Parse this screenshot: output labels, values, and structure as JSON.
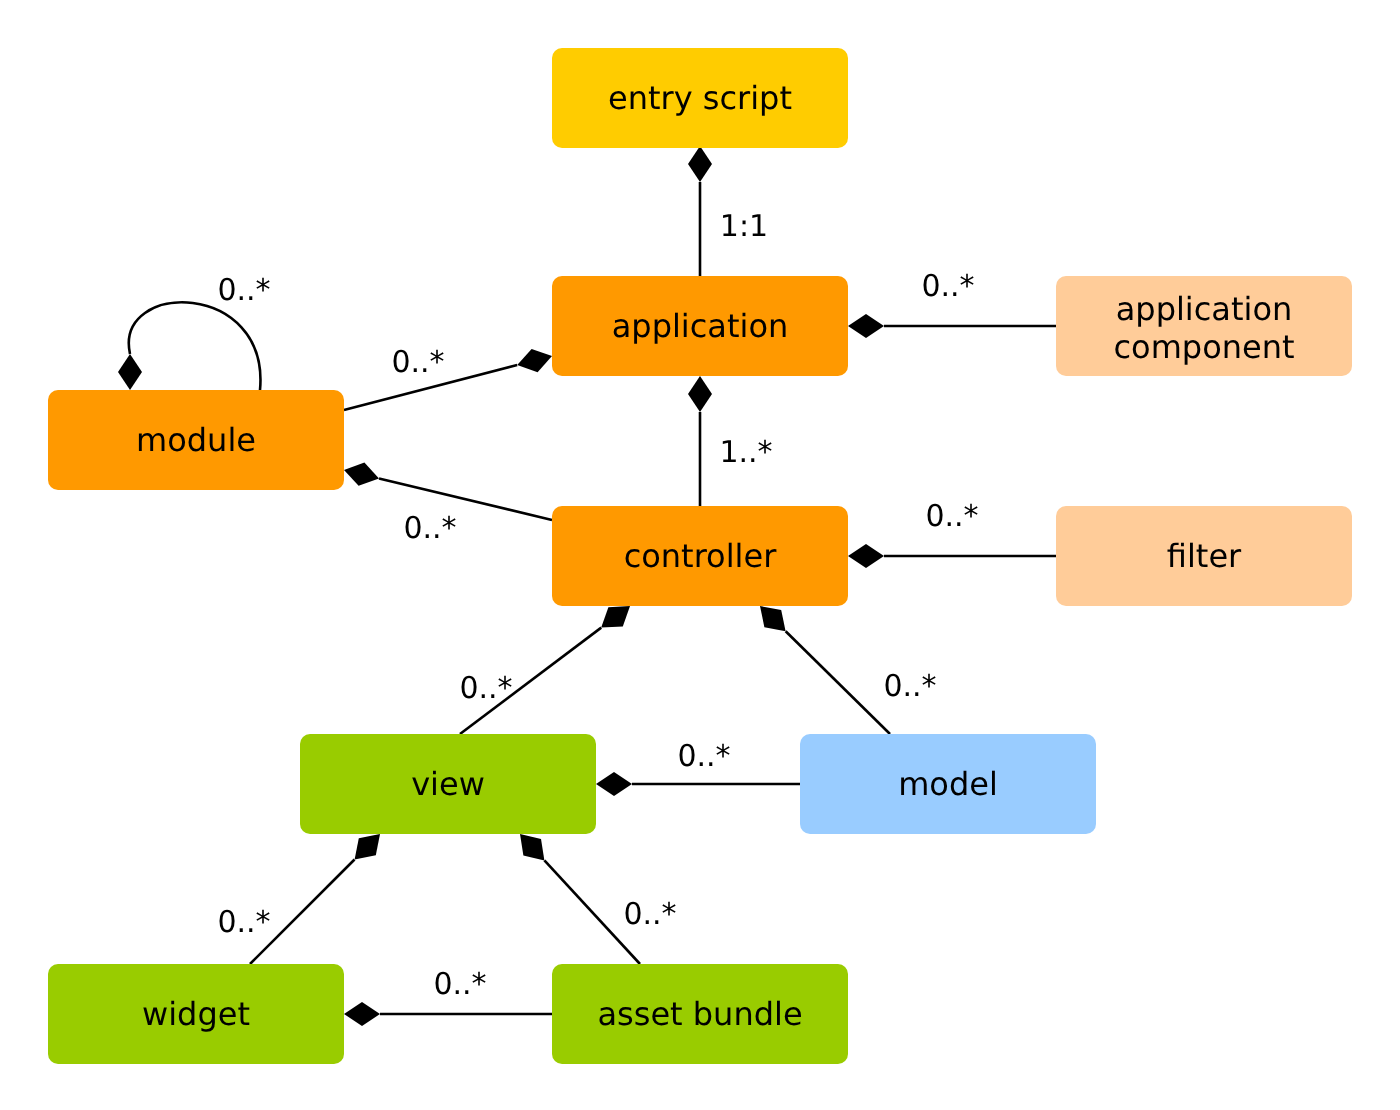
{
  "diagram": {
    "nodes": [
      {
        "label": "entry script",
        "color": "#ffcc00"
      },
      {
        "label": "application",
        "color": "#ff9900"
      },
      {
        "label": "application component",
        "color": "#ffcc99"
      },
      {
        "label": "module",
        "color": "#ff9900"
      },
      {
        "label": "controller",
        "color": "#ff9900"
      },
      {
        "label": "filter",
        "color": "#ffcc99"
      },
      {
        "label": "view",
        "color": "#99cc00"
      },
      {
        "label": "model",
        "color": "#99ccff"
      },
      {
        "label": "widget",
        "color": "#99cc00"
      },
      {
        "label": "asset bundle",
        "color": "#99cc00"
      }
    ],
    "edges": [
      {
        "label": "1:1"
      },
      {
        "label": "0..*"
      },
      {
        "label": "0..*"
      },
      {
        "label": "0..*",
        "kind": "loop"
      },
      {
        "label": "0..*"
      },
      {
        "label": "1..*"
      },
      {
        "label": "0..*"
      },
      {
        "label": "0..*"
      },
      {
        "label": "0..*"
      },
      {
        "label": "0..*"
      },
      {
        "label": "0..*"
      },
      {
        "label": "0..*"
      },
      {
        "label": "0..*"
      }
    ]
  }
}
